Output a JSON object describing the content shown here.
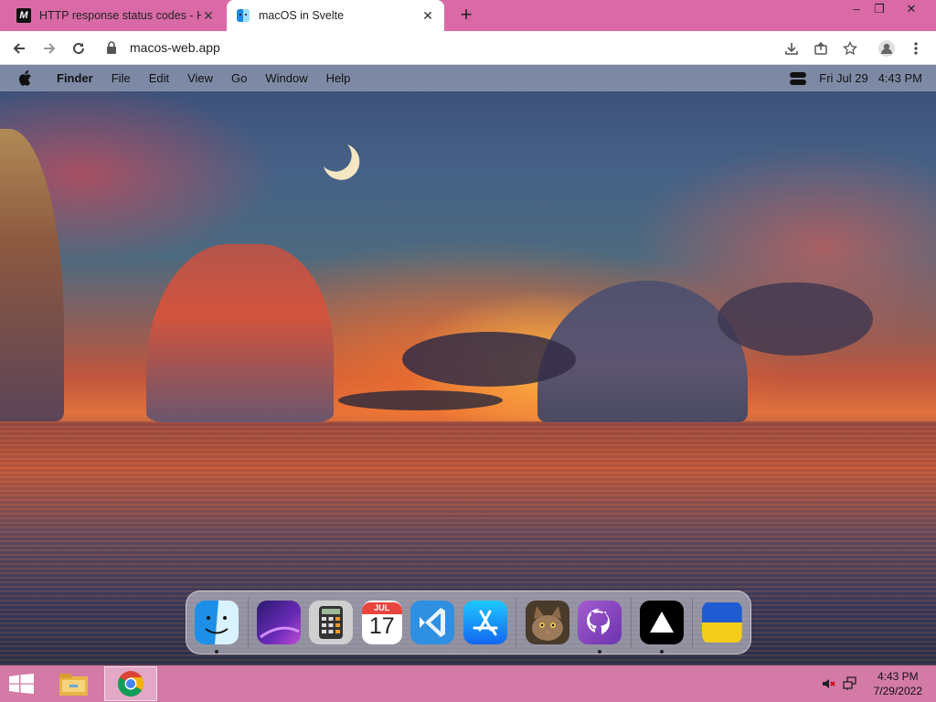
{
  "browser": {
    "tabs": [
      {
        "title": "HTTP response status codes - HT",
        "favicon": "mdn-icon",
        "active": false
      },
      {
        "title": "macOS in Svelte",
        "favicon": "macos-web-icon",
        "active": true
      }
    ],
    "new_tab_label": "+",
    "window_controls": {
      "minimize": "–",
      "restore": "❐",
      "close": "✕"
    },
    "address": "macos-web.app"
  },
  "macos": {
    "menubar": {
      "app_name": "Finder",
      "items": [
        "File",
        "Edit",
        "View",
        "Go",
        "Window",
        "Help"
      ],
      "clock": "Fri Jul 29   4:43 PM"
    },
    "dock": {
      "calendar_month": "JUL",
      "calendar_day": "17",
      "items": [
        {
          "name": "Finder",
          "icon": "finder-icon",
          "running": true
        },
        {
          "name": "Wallpapers",
          "icon": "wallpapers-icon",
          "running": false
        },
        {
          "name": "Calculator",
          "icon": "calculator-icon",
          "running": false
        },
        {
          "name": "Calendar",
          "icon": "calendar-icon",
          "running": false
        },
        {
          "name": "VS Code",
          "icon": "vscode-icon",
          "running": false
        },
        {
          "name": "App Store",
          "icon": "appstore-icon",
          "running": false
        },
        {
          "name": "Purr",
          "icon": "cat-icon",
          "running": false
        },
        {
          "name": "GitHub",
          "icon": "github-icon",
          "running": true
        },
        {
          "name": "Vercel",
          "icon": "vercel-icon",
          "running": true
        },
        {
          "name": "Ukraine",
          "icon": "ukraine-flag-icon",
          "running": true
        }
      ]
    }
  },
  "taskbar": {
    "time": "4:43 PM",
    "date": "7/29/2022"
  },
  "colors": {
    "tabstrip": "#d96aa6",
    "taskbar": "#d47aa7",
    "menubar": "rgba(180,185,200,0.55)"
  }
}
